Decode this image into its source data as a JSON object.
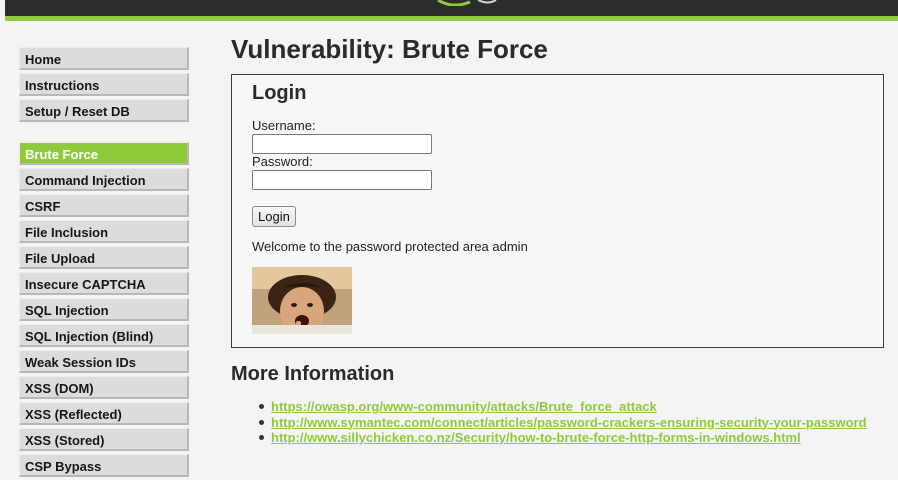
{
  "colors": {
    "accent": "#8fca3c",
    "header_bg": "#2c2c2c",
    "link": "#8fca3c"
  },
  "sidebar": {
    "top_items": [
      {
        "label": "Home"
      },
      {
        "label": "Instructions"
      },
      {
        "label": "Setup / Reset DB"
      }
    ],
    "vuln_items": [
      {
        "label": "Brute Force",
        "selected": true
      },
      {
        "label": "Command Injection"
      },
      {
        "label": "CSRF"
      },
      {
        "label": "File Inclusion"
      },
      {
        "label": "File Upload"
      },
      {
        "label": "Insecure CAPTCHA"
      },
      {
        "label": "SQL Injection"
      },
      {
        "label": "SQL Injection (Blind)"
      },
      {
        "label": "Weak Session IDs"
      },
      {
        "label": "XSS (DOM)"
      },
      {
        "label": "XSS (Reflected)"
      },
      {
        "label": "XSS (Stored)"
      },
      {
        "label": "CSP Bypass"
      }
    ]
  },
  "main": {
    "title": "Vulnerability: Brute Force",
    "login": {
      "heading": "Login",
      "username_label": "Username:",
      "username_value": "",
      "password_label": "Password:",
      "password_value": "",
      "button_label": "Login",
      "welcome": "Welcome to the password protected area admin"
    },
    "more_info": {
      "heading": "More Information",
      "links": [
        "https://owasp.org/www-community/attacks/Brute_force_attack",
        "http://www.symantec.com/connect/articles/password-crackers-ensuring-security-your-password",
        "http://www.sillychicken.co.nz/Security/how-to-brute-force-http-forms-in-windows.html"
      ]
    }
  }
}
